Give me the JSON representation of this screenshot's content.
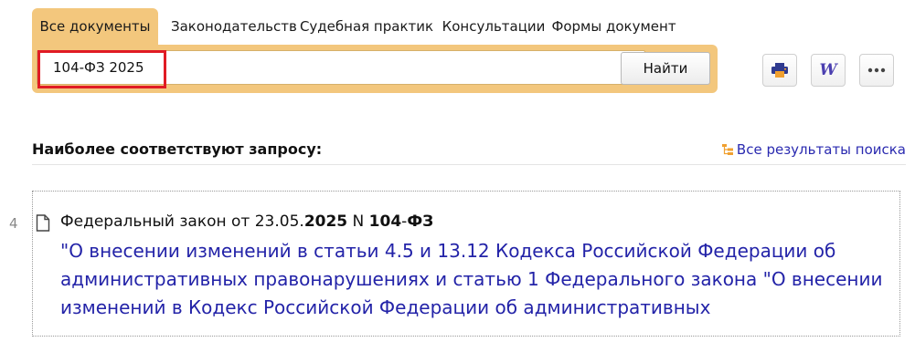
{
  "tabs": [
    {
      "label": "Все документы",
      "active": true
    },
    {
      "label": "Законодательств",
      "active": false
    },
    {
      "label": "Судебная практик",
      "active": false
    },
    {
      "label": "Консультации",
      "active": false
    },
    {
      "label": "Формы документ",
      "active": false
    }
  ],
  "search": {
    "value": "104-ФЗ 2025",
    "find_label": "Найти",
    "clear_icon": "close-icon"
  },
  "toolbar": {
    "print_icon": "printer-icon",
    "word_label": "W",
    "more_icon": "more-dots-icon"
  },
  "results": {
    "header": "Наиболее соответствуют запросу:",
    "all_results_label": "Все результаты поиска",
    "items": [
      {
        "number": "4",
        "heading_prefix": "Федеральный закон от 23.05.",
        "heading_year": "2025",
        "heading_mid": " N ",
        "heading_num": "104",
        "heading_dash": "-",
        "heading_fz": "ФЗ",
        "title": "\"О внесении изменений в статьи 4.5 и 13.12 Кодекса Российской Федерации об административных правонарушениях и статью 1 Федерального закона \"О внесении изменений в Кодекс Российской Федерации об административных"
      }
    ]
  },
  "colors": {
    "accent": "#f3c77d",
    "link": "#2323a8",
    "highlight": "#e01b24",
    "printer_blue": "#2f3a8f",
    "printer_orange": "#f0a030"
  }
}
